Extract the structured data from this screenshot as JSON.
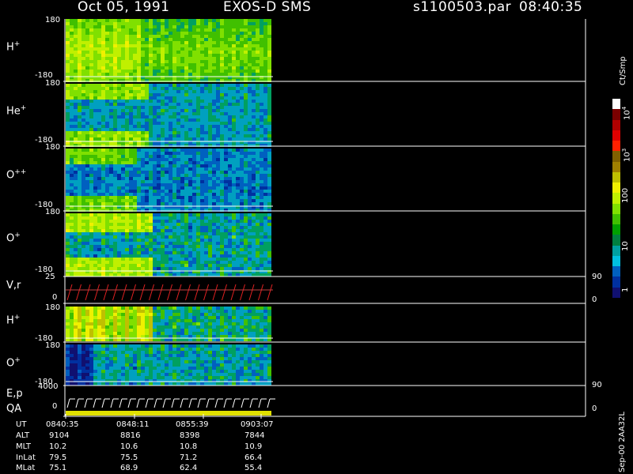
{
  "header": {
    "date": "Oct 05, 1991",
    "mission": "EXOS-D SMS",
    "file": "s1100503.par",
    "time": "08:40:35"
  },
  "panels": {
    "h_plus": {
      "label": "H",
      "sup": "+",
      "top": "180",
      "bottom": "-180"
    },
    "he_plus": {
      "label": "He",
      "sup": "+",
      "top": "180",
      "bottom": "-180"
    },
    "o_plusplus": {
      "label": "O",
      "sup": "++",
      "top": "180",
      "bottom": "-180"
    },
    "o_plus": {
      "label": "O",
      "sup": "+",
      "top": "180",
      "bottom": "-180"
    },
    "vr": {
      "label": "V,r",
      "top": "25",
      "bottom": "0",
      "right_top": "90",
      "right_bottom": "0"
    },
    "h_plus2": {
      "label": "H",
      "sup": "+",
      "top": "180",
      "bottom": "-180"
    },
    "o_plus2": {
      "label": "O",
      "sup": "+",
      "top": "180",
      "bottom": "-180"
    },
    "ep": {
      "label": "E,p",
      "top": "4000",
      "bottom": "0",
      "right_top": "90",
      "right_bottom": "0"
    },
    "qa": {
      "label": "QA"
    }
  },
  "colorbar": {
    "unit": "Ct/Smp",
    "ticks": [
      "10",
      "10",
      "100",
      "10",
      "1"
    ],
    "tick_exponents": [
      "4",
      "3",
      "",
      "",
      ""
    ],
    "colors": [
      "#ffffff",
      "#7a0000",
      "#b00000",
      "#e00000",
      "#ff2000",
      "#806000",
      "#a08000",
      "#c0c000",
      "#f0f000",
      "#c0f000",
      "#80e000",
      "#40c000",
      "#00a000",
      "#008040",
      "#00a0a0",
      "#00c0e0",
      "#0060c0",
      "#0030a0",
      "#101070"
    ]
  },
  "side_text": "Sep-00  2AA32L",
  "footer": {
    "rows": [
      {
        "name": "UT",
        "values": [
          "0840:35",
          "0848:11",
          "0855:39",
          "0903:07"
        ]
      },
      {
        "name": "ALT",
        "values": [
          "9104",
          "8816",
          "8398",
          "7844"
        ]
      },
      {
        "name": "MLT",
        "values": [
          "10.2",
          "10.6",
          "10.8",
          "10.9"
        ]
      },
      {
        "name": "InLat",
        "values": [
          "79.5",
          "75.5",
          "71.2",
          "66.4"
        ]
      },
      {
        "name": "MLat",
        "values": [
          "75.1",
          "68.9",
          "62.4",
          "55.4"
        ]
      }
    ]
  },
  "chart_data": {
    "type": "heatmap",
    "title": "Oct 05, 1991   EXOS-D SMS",
    "panels": [
      "H+",
      "He+",
      "O++",
      "O+",
      "V,r",
      "H+",
      "O+",
      "E,p",
      "QA"
    ],
    "x_ticks": [
      "0840:35",
      "0848:11",
      "0855:39",
      "0903:07"
    ],
    "y_range_angle": [
      -180,
      180
    ],
    "colorbar_range": [
      1,
      10000
    ],
    "colorbar_scale": "log",
    "colorbar_unit": "Ct/Smp"
  }
}
